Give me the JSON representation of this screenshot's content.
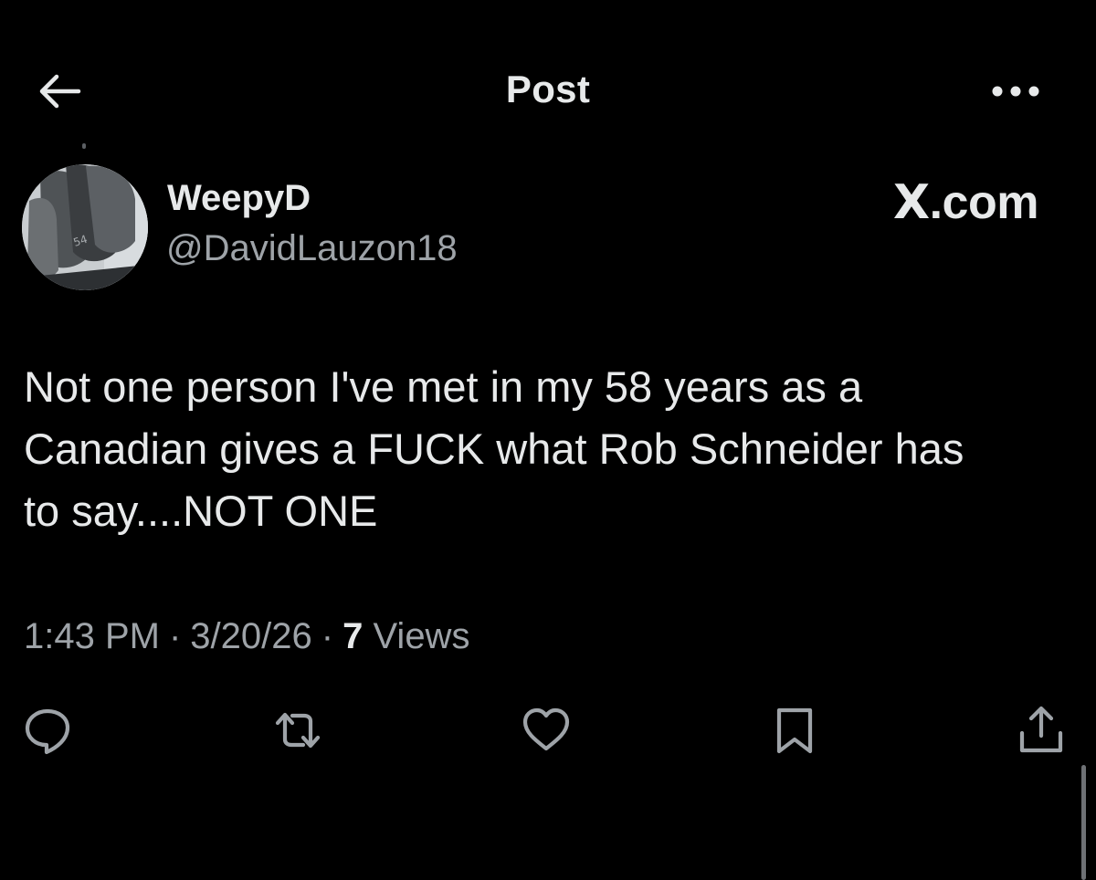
{
  "header": {
    "title": "Post",
    "back_icon": "back-arrow-icon",
    "more_icon": "more-horizontal-icon"
  },
  "author": {
    "display_name": "WeepyD",
    "handle": "@DavidLauzon18",
    "avatar_icon": "golf-wedges-avatar",
    "avatar_text": "54"
  },
  "watermark": {
    "x": "X",
    "rest": ".com"
  },
  "post": {
    "text": "Not one person I've met in my 58 years as a\nCanadian gives a FUCK what Rob Schneider has\nto say....NOT ONE"
  },
  "meta": {
    "time": "1:43 PM",
    "separator": "·",
    "date": "3/20/26",
    "views_count": "7",
    "views_label": "Views"
  },
  "actions": [
    {
      "name": "reply",
      "icon": "reply-icon"
    },
    {
      "name": "repost",
      "icon": "repost-icon"
    },
    {
      "name": "like",
      "icon": "heart-icon"
    },
    {
      "name": "bookmark",
      "icon": "bookmark-icon"
    },
    {
      "name": "share",
      "icon": "share-icon"
    }
  ],
  "colors": {
    "background": "#000000",
    "primary_text": "#e7e9ea",
    "secondary_text": "#9ea3a8",
    "icon": "#9ea3a8"
  }
}
